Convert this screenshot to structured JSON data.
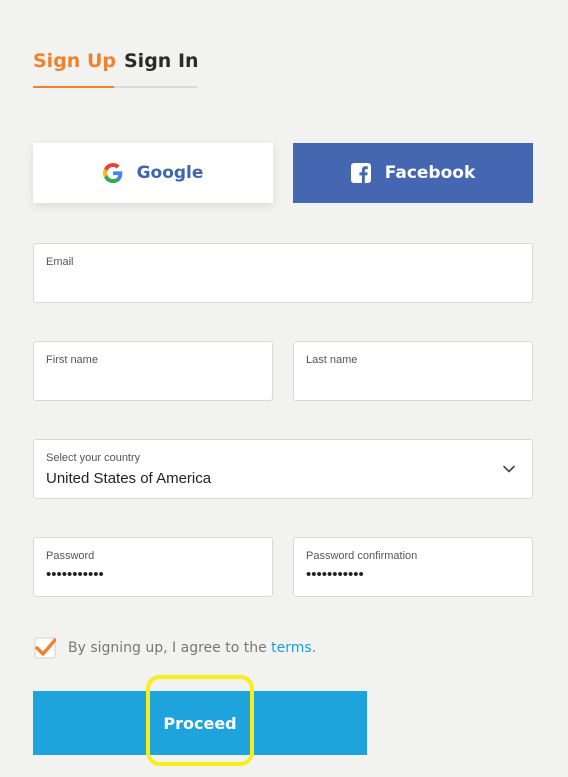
{
  "tabs": {
    "signup_label": "Sign Up",
    "signin_label": "Sign In",
    "active": "signup"
  },
  "social": {
    "google_label": "Google",
    "facebook_label": "Facebook"
  },
  "form": {
    "email": {
      "label": "Email",
      "value": ""
    },
    "first_name": {
      "label": "First name",
      "value": ""
    },
    "last_name": {
      "label": "Last name",
      "value": ""
    },
    "country": {
      "label": "Select your country",
      "value": "United States of America"
    },
    "password": {
      "label": "Password",
      "masked_value": "•••••••••••"
    },
    "password_confirmation": {
      "label": "Password confirmation",
      "masked_value": "•••••••••••"
    }
  },
  "terms": {
    "checked": true,
    "prefix": "By signing up, I agree to the ",
    "link_label": "terms",
    "suffix": "."
  },
  "proceed_label": "Proceed",
  "icons": {
    "google": "google-icon",
    "facebook": "facebook-icon",
    "chevron": "chevron-down-icon",
    "check": "checkmark-icon"
  },
  "colors": {
    "accent_orange": "#f0822d",
    "facebook_blue": "#4566b0",
    "proceed_blue": "#1ea3dd",
    "link_blue": "#1c9fd6",
    "highlight_yellow": "#f7ee1a",
    "background": "#f2f2f0"
  }
}
